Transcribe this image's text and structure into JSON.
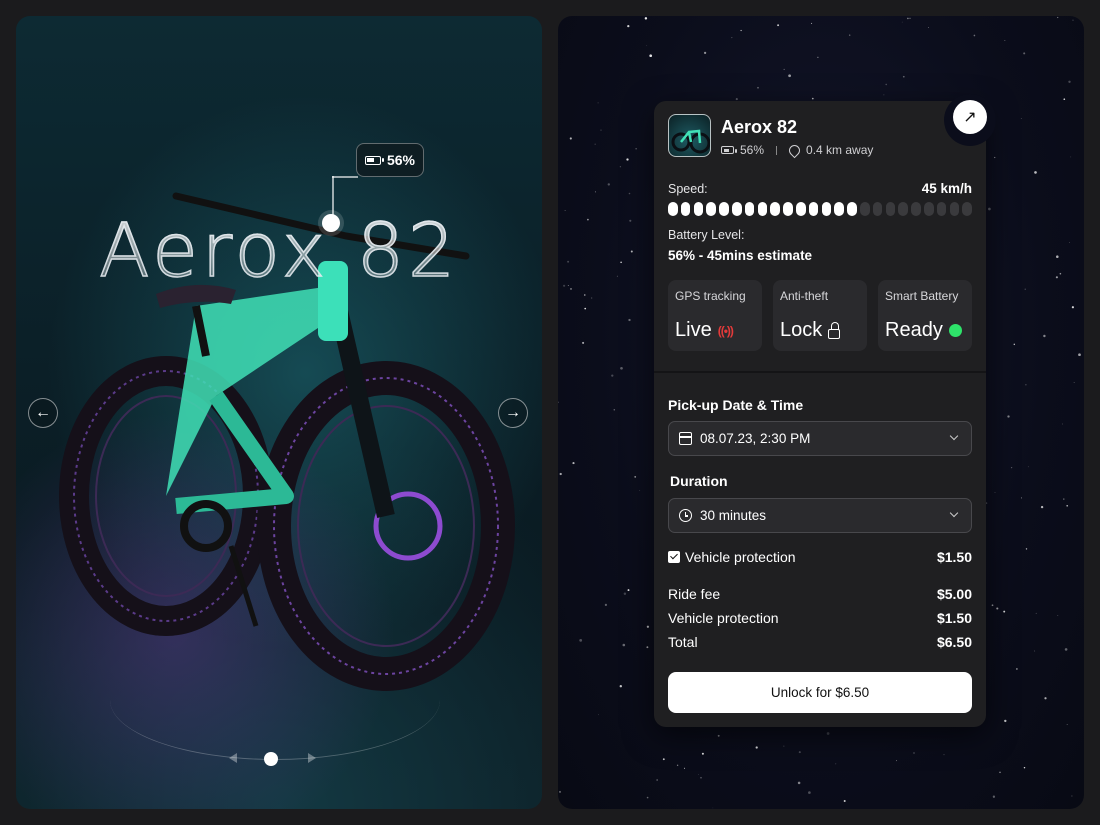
{
  "hero": {
    "title": "Aerox 82",
    "battery_chip": "56%",
    "prev_icon": "arrow-left-icon",
    "next_icon": "arrow-right-icon",
    "prev_glyph": "←",
    "next_glyph": "→"
  },
  "card": {
    "name": "Aerox 82",
    "battery": "56%",
    "distance": "0.4 km away",
    "external_glyph": "↗",
    "speed_label": "Speed:",
    "speed_value": "45 km/h",
    "speed_level": 0.62,
    "battery_label": "Battery Level:",
    "battery_value": "56% - 45mins estimate",
    "tiles": [
      {
        "label": "GPS tracking",
        "value": "Live",
        "icon": "signal-icon"
      },
      {
        "label": "Anti-theft",
        "value": "Lock",
        "icon": "lock-icon"
      },
      {
        "label": "Smart Battery",
        "value": "Ready",
        "icon": "status-dot-icon"
      }
    ],
    "pickup_label": "Pick-up Date & Time",
    "pickup_value": "08.07.23, 2:30 PM",
    "duration_label": "Duration",
    "duration_value": "30 minutes",
    "protection_label": "Vehicle protection",
    "protection_price": "$1.50",
    "protection_checked": true,
    "fees": [
      {
        "label": "Ride fee",
        "price": "$5.00"
      },
      {
        "label": "Vehicle protection",
        "price": "$1.50"
      },
      {
        "label": "Total",
        "price": "$6.50"
      }
    ],
    "unlock_label": "Unlock for $6.50"
  },
  "colors": {
    "accent_green": "#2ee36a",
    "signal_red": "#e23a3a",
    "card_bg": "#1f1f21"
  }
}
